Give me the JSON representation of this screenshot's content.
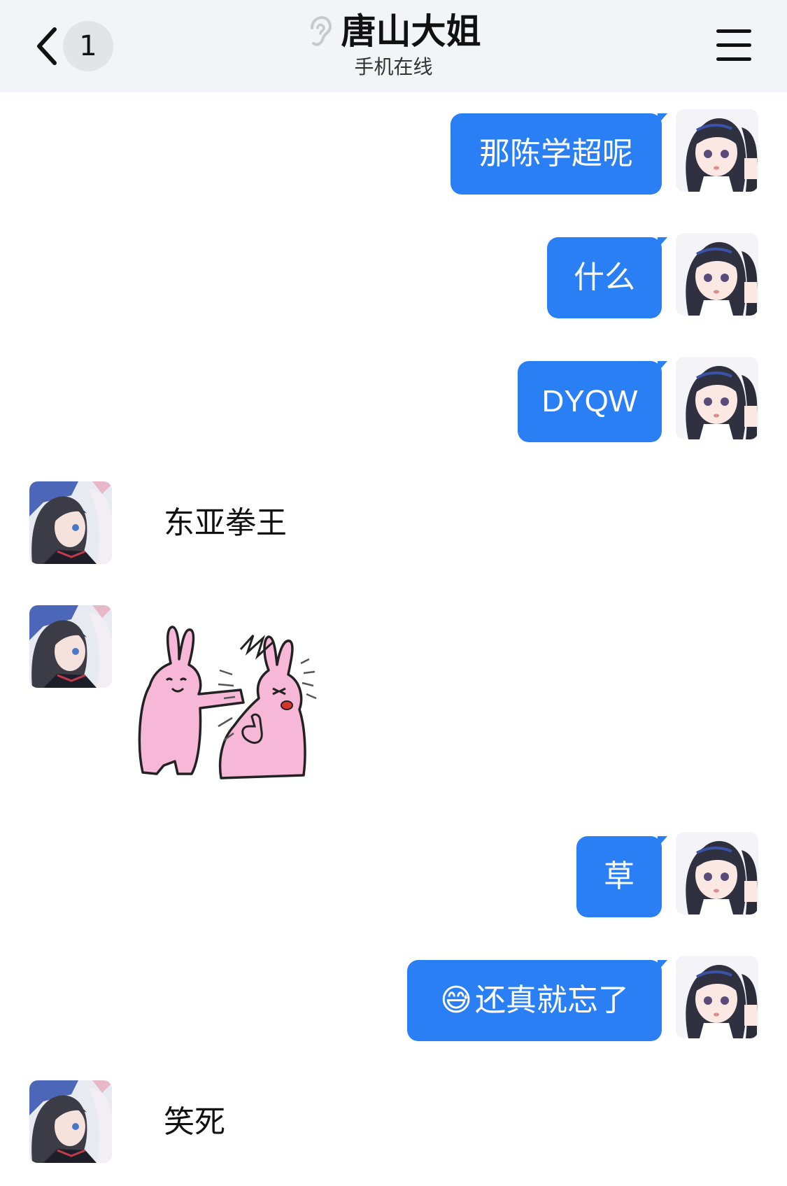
{
  "header": {
    "back_badge": "1",
    "title": "唐山大姐",
    "subtitle": "手机在线",
    "ear_icon": "ear-icon",
    "menu_icon": "hamburger-menu-icon"
  },
  "messages": [
    {
      "side": "out",
      "text": "那陈学超呢"
    },
    {
      "side": "out",
      "text": "什么"
    },
    {
      "side": "out",
      "text": "DYQW"
    },
    {
      "side": "in",
      "text": "东亚拳王"
    },
    {
      "side": "in",
      "sticker": "pink-rabbit-punch-sticker"
    },
    {
      "side": "out",
      "text": "草"
    },
    {
      "side": "out",
      "emoji": "😅",
      "text": "还真就忘了"
    },
    {
      "side": "in",
      "text": "笑死"
    }
  ],
  "colors": {
    "header_bg": "#f3f4f8",
    "bubble_out": "#2b7ff5",
    "text": "#111111"
  }
}
